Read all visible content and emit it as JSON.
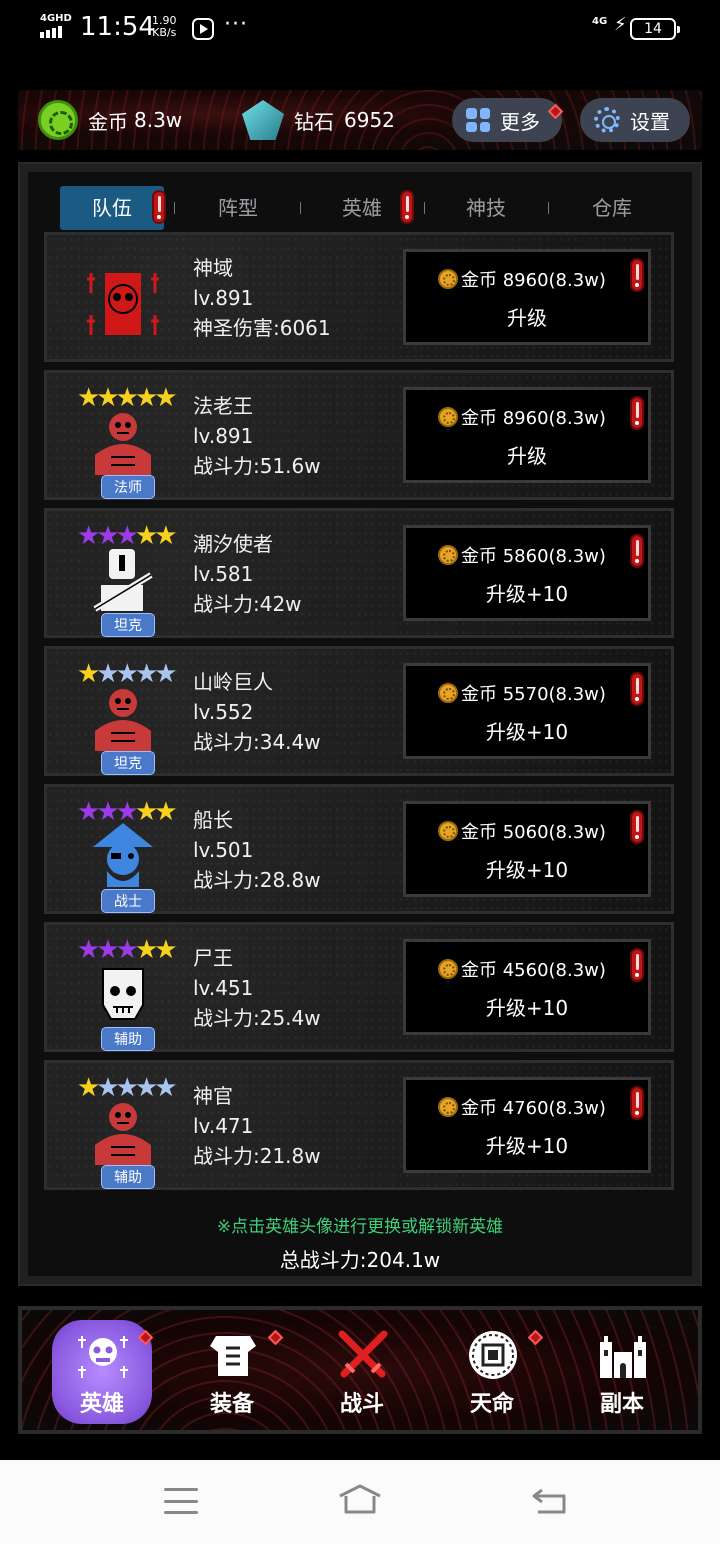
{
  "status_bar": {
    "network": "4GHD",
    "time": "11:54",
    "speed_value": "1.90",
    "speed_unit": "KB/s",
    "dots": "···",
    "signal": "4G",
    "battery": "14"
  },
  "resources": {
    "gold_label": "金币",
    "gold_value": "8.3w",
    "diamond_label": "钻石",
    "diamond_value": "6952",
    "more_label": "更多",
    "settings_label": "设置"
  },
  "tabs": [
    {
      "label": "队伍",
      "active": true,
      "alert": true
    },
    {
      "label": "阵型",
      "active": false,
      "alert": false
    },
    {
      "label": "英雄",
      "active": false,
      "alert": true
    },
    {
      "label": "神技",
      "active": false,
      "alert": false
    },
    {
      "label": "仓库",
      "active": false,
      "alert": false
    }
  ],
  "heroes": [
    {
      "name": "神域",
      "level": "lv.891",
      "stat": "神圣伤害:6061",
      "role": "",
      "stars": "",
      "cost": "金币 8960(8.3w)",
      "action": "升级",
      "art_color": "#d01818"
    },
    {
      "name": "法老王",
      "level": "lv.891",
      "stat": "战斗力:51.6w",
      "role": "法师",
      "stars": "★★★★★",
      "cost": "金币 8960(8.3w)",
      "action": "升级",
      "art_color": "#c83a3a"
    },
    {
      "name": "潮汐使者",
      "level": "lv.581",
      "stat": "战斗力:42w",
      "role": "坦克",
      "stars": "★★★★★",
      "cost": "金币 5860(8.3w)",
      "action": "升级+10",
      "art_color": "#f2f2f2"
    },
    {
      "name": "山岭巨人",
      "level": "lv.552",
      "stat": "战斗力:34.4w",
      "role": "坦克",
      "stars": "★★★★★",
      "cost": "金币 5570(8.3w)",
      "action": "升级+10",
      "art_color": "#c83a3a"
    },
    {
      "name": "船长",
      "level": "lv.501",
      "stat": "战斗力:28.8w",
      "role": "战士",
      "stars": "★★★★★",
      "cost": "金币 5060(8.3w)",
      "action": "升级+10",
      "art_color": "#3f86e0"
    },
    {
      "name": "尸王",
      "level": "lv.451",
      "stat": "战斗力:25.4w",
      "role": "辅助",
      "stars": "★★★★★",
      "cost": "金币 4560(8.3w)",
      "action": "升级+10",
      "art_color": "#f2f2f2"
    },
    {
      "name": "神官",
      "level": "lv.471",
      "stat": "战斗力:21.8w",
      "role": "辅助",
      "stars": "★★★★★",
      "cost": "金币 4760(8.3w)",
      "action": "升级+10",
      "art_color": "#c83a3a"
    }
  ],
  "star_colors": [
    [
      "#f6d21e",
      "#f6d21e",
      "#f6d21e",
      "#f6d21e",
      "#f6d21e"
    ],
    [
      "#f6d21e",
      "#f6d21e",
      "#f6d21e",
      "#f6d21e",
      "#f6d21e"
    ],
    [
      "#9b3ce8",
      "#9b3ce8",
      "#9b3ce8",
      "#f6d21e",
      "#f6d21e"
    ],
    [
      "#f6d21e",
      "#a9c4ee",
      "#a9c4ee",
      "#a9c4ee",
      "#a9c4ee"
    ],
    [
      "#9b3ce8",
      "#9b3ce8",
      "#9b3ce8",
      "#f6d21e",
      "#f6d21e"
    ],
    [
      "#9b3ce8",
      "#9b3ce8",
      "#9b3ce8",
      "#f6d21e",
      "#f6d21e"
    ],
    [
      "#f6d21e",
      "#a9c4ee",
      "#a9c4ee",
      "#a9c4ee",
      "#a9c4ee"
    ]
  ],
  "hint": "※点击英雄头像进行更换或解锁新英雄",
  "total_power": "总战斗力:204.1w",
  "bottom_nav": [
    {
      "label": "英雄",
      "icon": "hero-icon",
      "active": true
    },
    {
      "label": "装备",
      "icon": "armor-icon",
      "active": false
    },
    {
      "label": "战斗",
      "icon": "crossed-swords-icon",
      "active": false
    },
    {
      "label": "天命",
      "icon": "destiny-seal-icon",
      "active": false
    },
    {
      "label": "副本",
      "icon": "dungeon-castle-icon",
      "active": false
    }
  ],
  "colors": {
    "tab_active": "#1b5a82",
    "alert_red": "#c21616",
    "hint_green": "#3fd07a",
    "role_badge": "#4b79c9",
    "nav_active": "#8a5ae0"
  }
}
